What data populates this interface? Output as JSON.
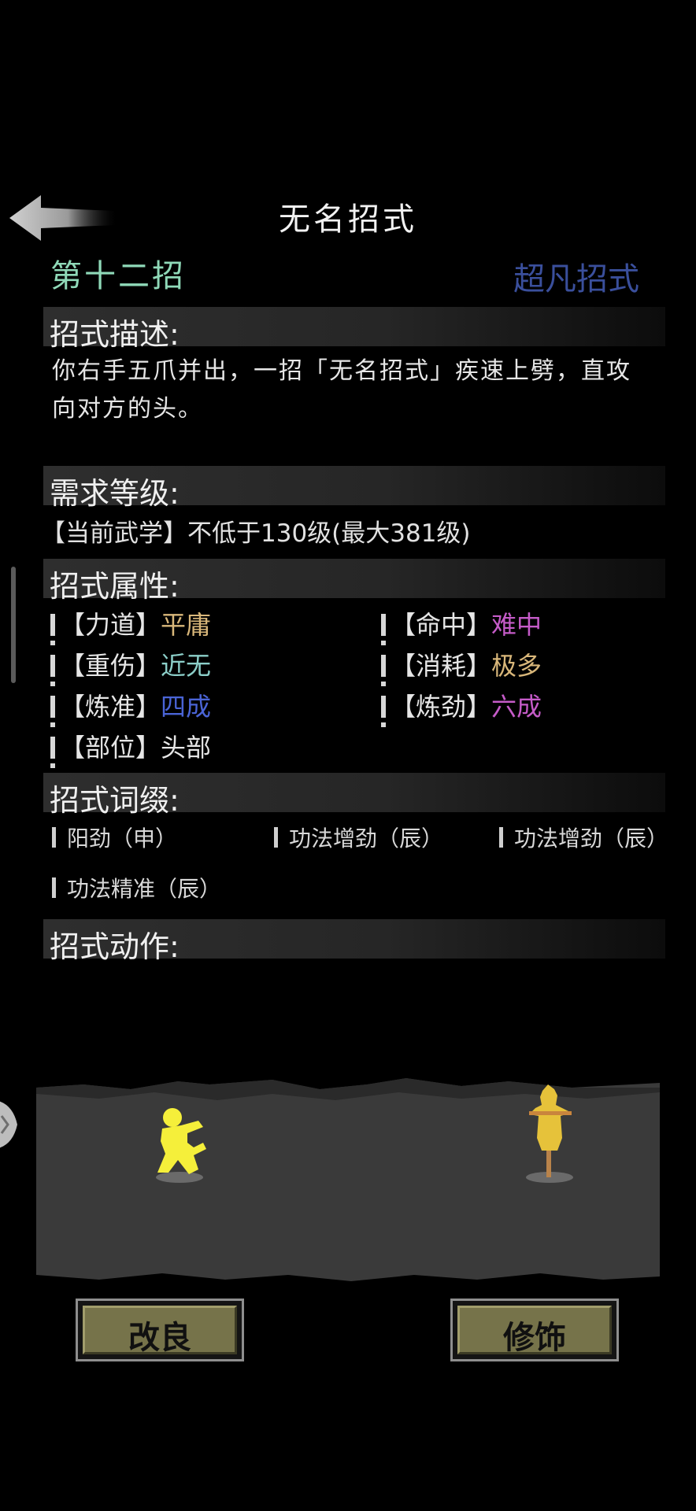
{
  "header": {
    "title": "无名招式",
    "move_index": "第十二招",
    "move_grade": "超凡招式"
  },
  "sections": {
    "description_title": "招式描述:",
    "description_text": "你右手五爪并出，一招「无名招式」疾速上劈，直攻向对方的头。",
    "level_title": "需求等级:",
    "level_text": "【当前武学】不低于130级(最大381级)",
    "attributes_title": "招式属性:",
    "affixes_title": "招式词缀:",
    "action_title": "招式动作:"
  },
  "attributes": [
    {
      "key": "【力道】",
      "value": "平庸",
      "color": "#d9b77a"
    },
    {
      "key": "【命中】",
      "value": "难中",
      "color": "#c55bc8"
    },
    {
      "key": "【重伤】",
      "value": "近无",
      "color": "#8ccfc9"
    },
    {
      "key": "【消耗】",
      "value": "极多",
      "color": "#d9b77a"
    },
    {
      "key": "【炼准】",
      "value": "四成",
      "color": "#4a64d6"
    },
    {
      "key": "【炼劲】",
      "value": "六成",
      "color": "#c55bc8"
    },
    {
      "key": "【部位】",
      "value": "头部",
      "color": "#e6e6e6"
    }
  ],
  "affixes": [
    "阳劲（申）",
    "功法增劲（辰）",
    "功法增劲（辰）",
    "功法精准（辰）"
  ],
  "buttons": {
    "improve": "改良",
    "decorate": "修饰"
  },
  "colors": {
    "background": "#000000",
    "move_index": "#8fd9b8",
    "move_grade": "#3a4f9c",
    "button_fill": "#76734a",
    "player_figure": "#f5ef3a",
    "target_dummy": "#e6c23a"
  },
  "icons": {
    "back": "back-arrow-icon",
    "player": "martial-artist-figure",
    "target": "training-dummy-figure",
    "side": "chevron-right-icon"
  }
}
